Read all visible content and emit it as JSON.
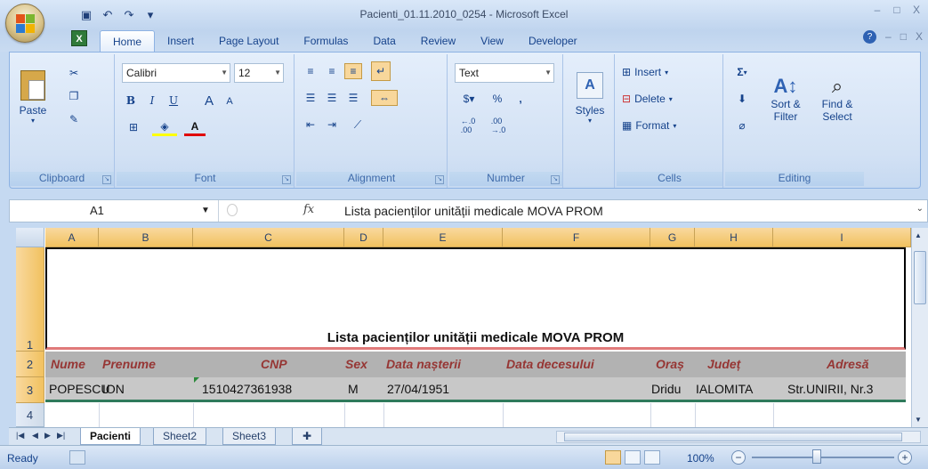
{
  "window": {
    "title": "Pacienti_01.11.2010_0254 - Microsoft Excel",
    "controls": [
      "–",
      "□",
      "X"
    ],
    "doc_controls": [
      "?",
      "–",
      "□",
      "X"
    ]
  },
  "quick_access": {
    "icons": [
      "save-icon",
      "undo-icon",
      "redo-icon",
      "customize-icon"
    ],
    "glyphs": [
      "▣",
      "↶",
      "↷",
      "₹"
    ]
  },
  "ribbon": {
    "tabs": [
      "Home",
      "Insert",
      "Page Layout",
      "Formulas",
      "Data",
      "Review",
      "View",
      "Developer"
    ],
    "active_tab": "Home",
    "clipboard": {
      "paste": "Paste",
      "label": "Clipboard"
    },
    "font": {
      "name": "Calibri",
      "size": "12",
      "bold": "B",
      "italic": "I",
      "underline": "U",
      "grow": "A",
      "shrink": "A",
      "label": "Font"
    },
    "alignment": {
      "label": "Alignment"
    },
    "number": {
      "format": "Text",
      "percent": "%",
      "comma": ",",
      "inc_dec": "+.0 .00",
      "dec_dec": ".00 →.0",
      "label": "Number"
    },
    "styles": {
      "label": "Styles"
    },
    "cells": {
      "insert": "Insert",
      "delete": "Delete",
      "format": "Format",
      "label": "Cells"
    },
    "editing": {
      "sigma": "Σ",
      "sort": "Sort &",
      "sort2": "Filter",
      "find": "Find &",
      "find2": "Select",
      "label": "Editing"
    }
  },
  "formula_bar": {
    "name_box": "A1",
    "fx": "fx",
    "content": "Lista pacienților unității medicale MOVA PROM"
  },
  "sheet": {
    "columns": [
      "A",
      "B",
      "C",
      "D",
      "E",
      "F",
      "G",
      "H",
      "I"
    ],
    "rows": [
      "1",
      "2",
      "3",
      "4"
    ],
    "title": "Lista pacienților unității medicale MOVA PROM",
    "headers": [
      "Nume",
      "Prenume",
      "CNP",
      "Sex",
      "Data nașterii",
      "Data decesului",
      "Oraș",
      "Județ",
      "Adresă"
    ],
    "data_rows": [
      [
        "POPESCU",
        "ION",
        "1510427361938",
        "M",
        "27/04/1951",
        "",
        "Dridu",
        "IALOMITA",
        "Str.UNIRII, Nr.3"
      ]
    ]
  },
  "sheet_tabs": {
    "tabs": [
      "Pacienti",
      "Sheet2",
      "Sheet3"
    ],
    "active": "Pacienti"
  },
  "status": {
    "text": "Ready",
    "zoom": "100%"
  },
  "colors": {
    "header_text": "#963634",
    "header_fill": "#b2b2b2",
    "row_fill": "#c8c8c8",
    "selected_column_header": "#f1c15f"
  }
}
